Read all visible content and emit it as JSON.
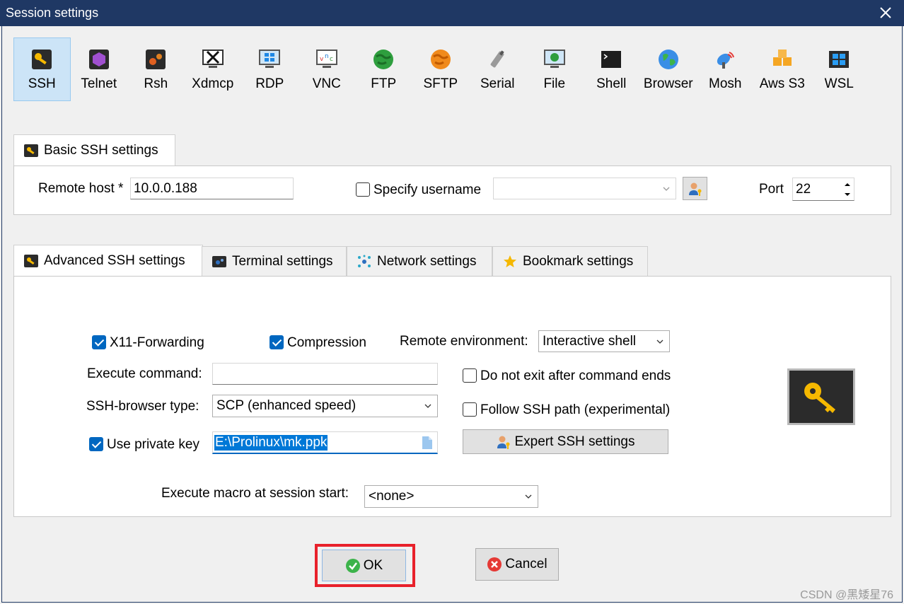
{
  "window": {
    "title": "Session settings"
  },
  "session_types": [
    {
      "label": "SSH",
      "icon": "key-icon",
      "selected": true
    },
    {
      "label": "Telnet",
      "icon": "telnet-icon"
    },
    {
      "label": "Rsh",
      "icon": "rsh-icon"
    },
    {
      "label": "Xdmcp",
      "icon": "xdmcp-icon"
    },
    {
      "label": "RDP",
      "icon": "rdp-icon"
    },
    {
      "label": "VNC",
      "icon": "vnc-icon"
    },
    {
      "label": "FTP",
      "icon": "ftp-icon"
    },
    {
      "label": "SFTP",
      "icon": "sftp-icon"
    },
    {
      "label": "Serial",
      "icon": "serial-icon"
    },
    {
      "label": "File",
      "icon": "file-icon"
    },
    {
      "label": "Shell",
      "icon": "shell-icon"
    },
    {
      "label": "Browser",
      "icon": "globe-icon"
    },
    {
      "label": "Mosh",
      "icon": "satellite-icon"
    },
    {
      "label": "Aws S3",
      "icon": "aws-s3-icon"
    },
    {
      "label": "WSL",
      "icon": "windows-icon"
    }
  ],
  "basic": {
    "tab_label": "Basic SSH settings",
    "remote_host_label": "Remote host *",
    "remote_host_value": "10.0.0.188",
    "specify_username_label": "Specify username",
    "specify_username_checked": false,
    "username_value": "",
    "port_label": "Port",
    "port_value": "22"
  },
  "tabs": [
    {
      "label": "Advanced SSH settings",
      "icon": "key-icon",
      "active": true
    },
    {
      "label": "Terminal settings",
      "icon": "terminal-icon"
    },
    {
      "label": "Network settings",
      "icon": "network-icon"
    },
    {
      "label": "Bookmark settings",
      "icon": "star-icon"
    }
  ],
  "advanced": {
    "x11_label": "X11-Forwarding",
    "x11_checked": true,
    "compression_label": "Compression",
    "compression_checked": true,
    "remote_env_label": "Remote environment:",
    "remote_env_value": "Interactive shell",
    "exec_cmd_label": "Execute command:",
    "exec_cmd_value": "",
    "no_exit_label": "Do not exit after command ends",
    "no_exit_checked": false,
    "browser_type_label": "SSH-browser type:",
    "browser_type_value": "SCP (enhanced speed)",
    "follow_path_label": "Follow SSH path (experimental)",
    "follow_path_checked": false,
    "private_key_label": "Use private key",
    "private_key_checked": true,
    "private_key_value": "E:\\Prolinux\\mk.ppk",
    "expert_button": "Expert SSH settings",
    "macro_label": "Execute macro at session start:",
    "macro_value": "<none>"
  },
  "footer": {
    "ok_label": "OK",
    "cancel_label": "Cancel"
  },
  "watermark": "CSDN @黑矮星76",
  "colors": {
    "titlebar": "#1f3864",
    "selected_bg": "#cce4f7",
    "check_blue": "#0067c0",
    "highlight_red": "#e8212b"
  }
}
